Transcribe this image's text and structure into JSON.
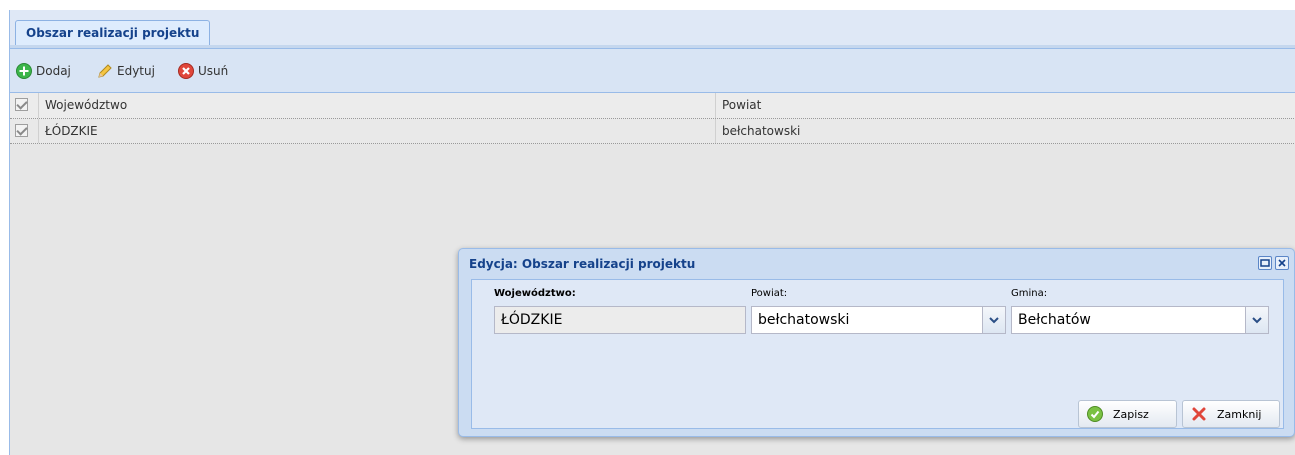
{
  "tab": {
    "label": "Obszar realizacji projektu"
  },
  "toolbar": {
    "add_label": "Dodaj",
    "edit_label": "Edytuj",
    "delete_label": "Usuń"
  },
  "grid": {
    "columns": [
      "Województwo",
      "Powiat"
    ],
    "rows": [
      {
        "wojewodztwo": "ŁÓDZKIE",
        "powiat": "bełchatowski",
        "checked": true
      }
    ]
  },
  "dialog": {
    "title": "Edycja: Obszar realizacji projektu",
    "fields": {
      "wojewodztwo_label": "Województwo:",
      "wojewodztwo_value": "ŁÓDZKIE",
      "powiat_label": "Powiat:",
      "powiat_value": "bełchatowski",
      "gmina_label": "Gmina:",
      "gmina_value": "Bełchatów"
    },
    "save_label": "Zapisz",
    "close_label": "Zamknij"
  },
  "colors": {
    "accent": "#15428b",
    "border": "#99bbe8",
    "add": "#3cb54a",
    "delete": "#e0463a"
  },
  "icons": [
    "add-icon",
    "edit-icon",
    "delete-icon",
    "maximize-icon",
    "close-icon",
    "chevron-down-icon",
    "check-icon",
    "cancel-icon"
  ]
}
